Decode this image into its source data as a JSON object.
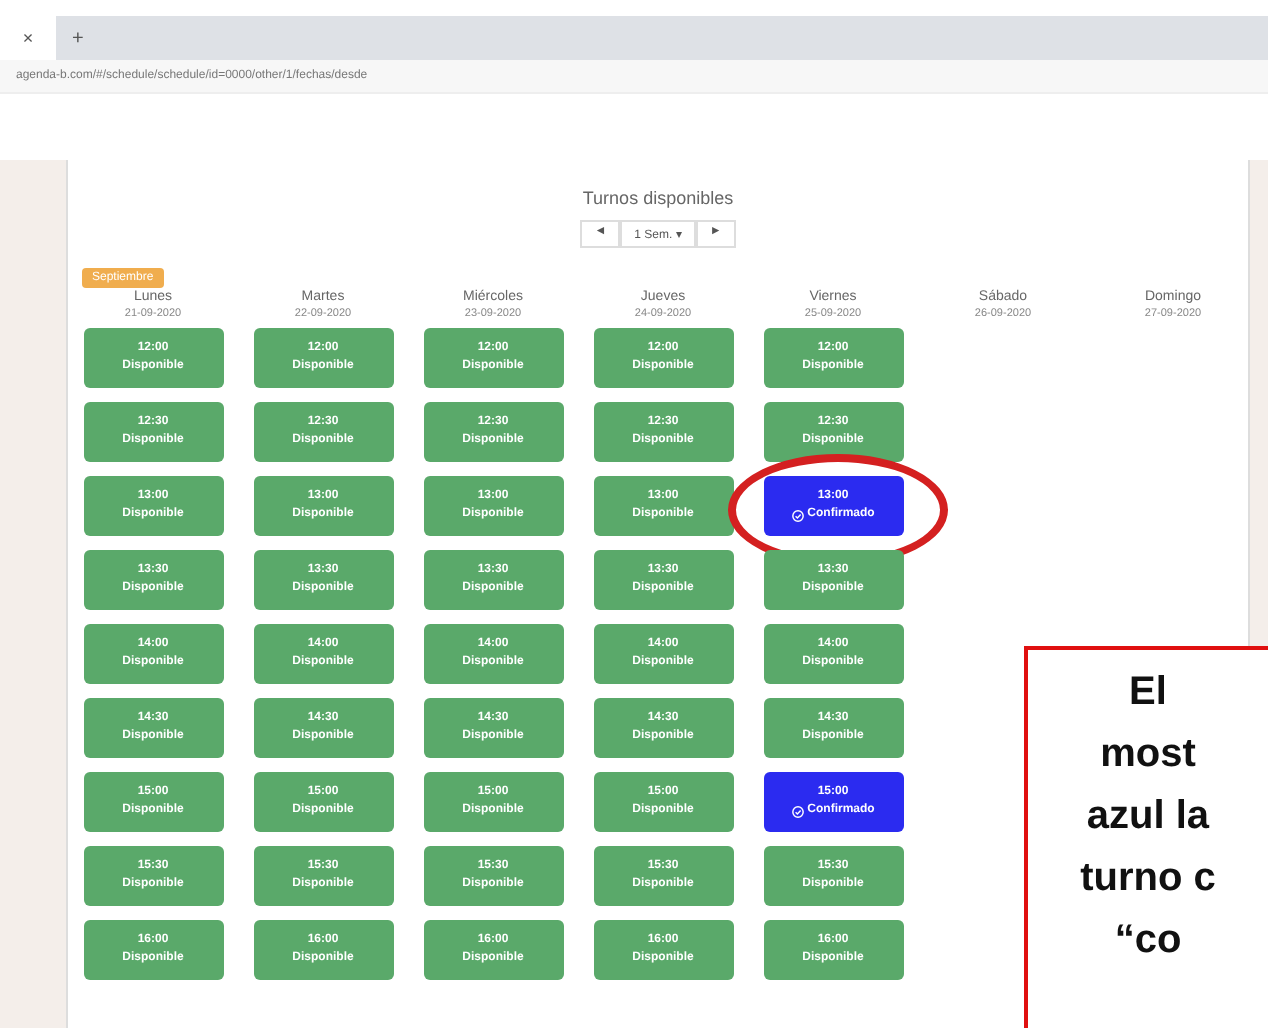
{
  "browser": {
    "tab_close": "×",
    "new_tab": "+",
    "url": "agenda-b.com/#/schedule/schedule/id=0000/other/1/fechas/desde"
  },
  "agenda": {
    "title": "Turnos disponibles",
    "nav": {
      "prev": "◄",
      "period": "1 Sem. ▾",
      "next": "►"
    },
    "month_badge": "Septiembre",
    "days": [
      {
        "name": "Lunes",
        "date": "21-09-2020",
        "slots": [
          {
            "time": "12:00",
            "label": "Disponible",
            "kind": "available"
          },
          {
            "time": "12:30",
            "label": "Disponible",
            "kind": "available"
          },
          {
            "time": "13:00",
            "label": "Disponible",
            "kind": "available"
          },
          {
            "time": "13:30",
            "label": "Disponible",
            "kind": "available"
          },
          {
            "time": "14:00",
            "label": "Disponible",
            "kind": "available"
          },
          {
            "time": "14:30",
            "label": "Disponible",
            "kind": "available"
          },
          {
            "time": "15:00",
            "label": "Disponible",
            "kind": "available"
          },
          {
            "time": "15:30",
            "label": "Disponible",
            "kind": "available"
          },
          {
            "time": "16:00",
            "label": "Disponible",
            "kind": "available"
          }
        ]
      },
      {
        "name": "Martes",
        "date": "22-09-2020",
        "slots": [
          {
            "time": "12:00",
            "label": "Disponible",
            "kind": "available"
          },
          {
            "time": "12:30",
            "label": "Disponible",
            "kind": "available"
          },
          {
            "time": "13:00",
            "label": "Disponible",
            "kind": "available"
          },
          {
            "time": "13:30",
            "label": "Disponible",
            "kind": "available"
          },
          {
            "time": "14:00",
            "label": "Disponible",
            "kind": "available"
          },
          {
            "time": "14:30",
            "label": "Disponible",
            "kind": "available"
          },
          {
            "time": "15:00",
            "label": "Disponible",
            "kind": "available"
          },
          {
            "time": "15:30",
            "label": "Disponible",
            "kind": "available"
          },
          {
            "time": "16:00",
            "label": "Disponible",
            "kind": "available"
          }
        ]
      },
      {
        "name": "Miércoles",
        "date": "23-09-2020",
        "slots": [
          {
            "time": "12:00",
            "label": "Disponible",
            "kind": "available"
          },
          {
            "time": "12:30",
            "label": "Disponible",
            "kind": "available"
          },
          {
            "time": "13:00",
            "label": "Disponible",
            "kind": "available"
          },
          {
            "time": "13:30",
            "label": "Disponible",
            "kind": "available"
          },
          {
            "time": "14:00",
            "label": "Disponible",
            "kind": "available"
          },
          {
            "time": "14:30",
            "label": "Disponible",
            "kind": "available"
          },
          {
            "time": "15:00",
            "label": "Disponible",
            "kind": "available"
          },
          {
            "time": "15:30",
            "label": "Disponible",
            "kind": "available"
          },
          {
            "time": "16:00",
            "label": "Disponible",
            "kind": "available"
          }
        ]
      },
      {
        "name": "Jueves",
        "date": "24-09-2020",
        "slots": [
          {
            "time": "12:00",
            "label": "Disponible",
            "kind": "available"
          },
          {
            "time": "12:30",
            "label": "Disponible",
            "kind": "available"
          },
          {
            "time": "13:00",
            "label": "Disponible",
            "kind": "available"
          },
          {
            "time": "13:30",
            "label": "Disponible",
            "kind": "available"
          },
          {
            "time": "14:00",
            "label": "Disponible",
            "kind": "available"
          },
          {
            "time": "14:30",
            "label": "Disponible",
            "kind": "available"
          },
          {
            "time": "15:00",
            "label": "Disponible",
            "kind": "available"
          },
          {
            "time": "15:30",
            "label": "Disponible",
            "kind": "available"
          },
          {
            "time": "16:00",
            "label": "Disponible",
            "kind": "available"
          }
        ]
      },
      {
        "name": "Viernes",
        "date": "25-09-2020",
        "slots": [
          {
            "time": "12:00",
            "label": "Disponible",
            "kind": "available"
          },
          {
            "time": "12:30",
            "label": "Disponible",
            "kind": "available"
          },
          {
            "time": "13:00",
            "label": "Confirmado",
            "kind": "confirmed",
            "circled": true
          },
          {
            "time": "13:30",
            "label": "Disponible",
            "kind": "available"
          },
          {
            "time": "14:00",
            "label": "Disponible",
            "kind": "available"
          },
          {
            "time": "14:30",
            "label": "Disponible",
            "kind": "available"
          },
          {
            "time": "15:00",
            "label": "Confirmado",
            "kind": "confirmed"
          },
          {
            "time": "15:30",
            "label": "Disponible",
            "kind": "available"
          },
          {
            "time": "16:00",
            "label": "Disponible",
            "kind": "available"
          }
        ]
      },
      {
        "name": "Sábado",
        "date": "26-09-2020"
      },
      {
        "name": "Domingo",
        "date": "27-09-2020"
      }
    ]
  },
  "annotation": {
    "lines": [
      "El",
      "most",
      "azul la",
      "turno c",
      "“co"
    ]
  }
}
